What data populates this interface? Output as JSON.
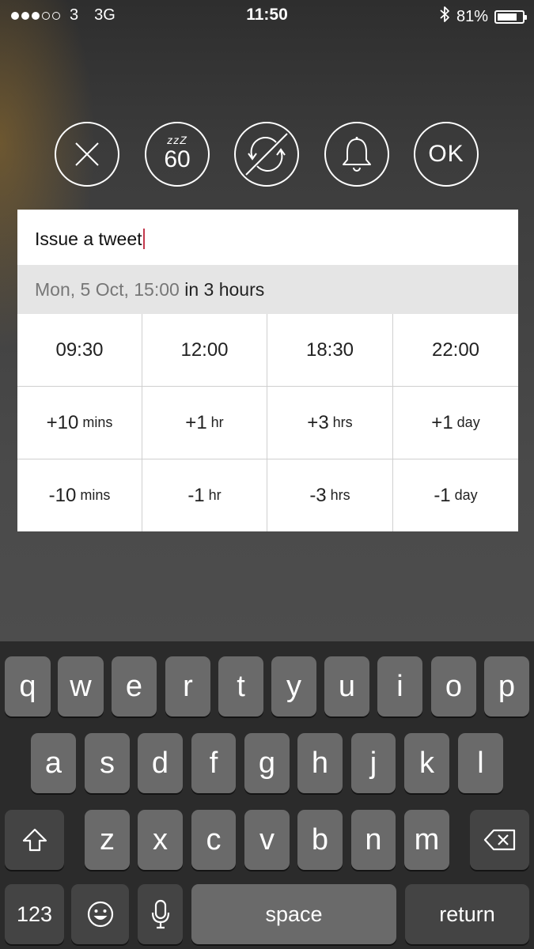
{
  "status_bar": {
    "signal_dots_filled": 3,
    "signal_dots_total": 5,
    "carrier": "3",
    "network": "3G",
    "time": "11:50",
    "battery_percent": "81%",
    "battery_level": 0.81,
    "icons": [
      "bluetooth-icon",
      "battery-icon"
    ]
  },
  "actions": [
    {
      "name": "close",
      "icon": "close-icon"
    },
    {
      "name": "snooze",
      "icon": "snooze-icon",
      "zzz": "zzZ",
      "minutes": "60"
    },
    {
      "name": "no-repeat",
      "icon": "no-repeat-icon"
    },
    {
      "name": "alarm",
      "icon": "bell-icon"
    },
    {
      "name": "ok",
      "label": "OK"
    }
  ],
  "reminder": {
    "title": "Issue a tweet",
    "date": "Mon, 5 Oct, 15:00",
    "relative": "in 3 hours"
  },
  "quick_times": {
    "row1": [
      "09:30",
      "12:00",
      "18:30",
      "22:00"
    ],
    "row2": [
      {
        "amount": "+10",
        "unit": "mins"
      },
      {
        "amount": "+1",
        "unit": "hr"
      },
      {
        "amount": "+3",
        "unit": "hrs"
      },
      {
        "amount": "+1",
        "unit": "day"
      }
    ],
    "row3": [
      {
        "amount": "-10",
        "unit": "mins"
      },
      {
        "amount": "-1",
        "unit": "hr"
      },
      {
        "amount": "-3",
        "unit": "hrs"
      },
      {
        "amount": "-1",
        "unit": "day"
      }
    ]
  },
  "keyboard": {
    "row1": [
      "q",
      "w",
      "e",
      "r",
      "t",
      "y",
      "u",
      "i",
      "o",
      "p"
    ],
    "row2": [
      "a",
      "s",
      "d",
      "f",
      "g",
      "h",
      "j",
      "k",
      "l"
    ],
    "row3": [
      "z",
      "x",
      "c",
      "v",
      "b",
      "n",
      "m"
    ],
    "numbers": "123",
    "space": "space",
    "return": "return",
    "icons": [
      "shift-icon",
      "backspace-icon",
      "emoji-icon",
      "microphone-icon"
    ]
  },
  "colors": {
    "caret": "#c3384c",
    "date_row_bg": "#e5e5e5",
    "key_bg": "#6a6a6a",
    "key_dark_bg": "#444444",
    "keyboard_bg": "#2b2b2b"
  }
}
